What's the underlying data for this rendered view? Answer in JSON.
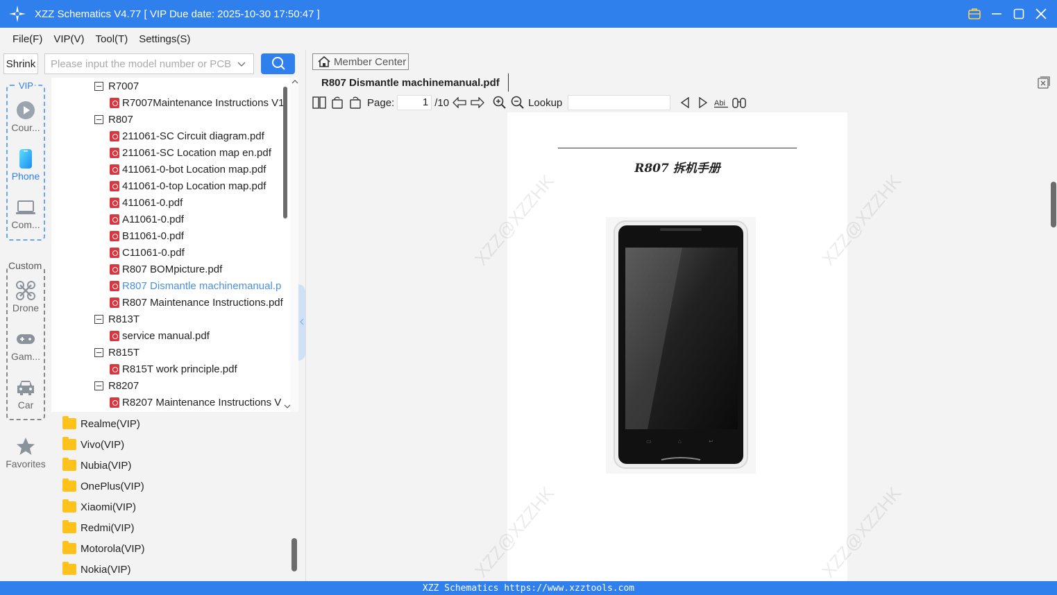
{
  "window": {
    "title": "XZZ Schematics V4.77 [ VIP Due date: 2025-10-30 17:50:47 ]"
  },
  "menu": [
    "File(F)",
    "VIP(V)",
    "Tool(T)",
    "Settings(S)"
  ],
  "search": {
    "shrink_label": "Shrink",
    "placeholder": "Please input the model number or PCB"
  },
  "nav": {
    "vip_label": "VIP",
    "custom_label": "Custom",
    "items": [
      {
        "label": "Cour...",
        "icon": "play-circle-icon"
      },
      {
        "label": "Phone",
        "icon": "phone-icon"
      },
      {
        "label": "Com...",
        "icon": "laptop-icon"
      },
      {
        "label": "Drone",
        "icon": "drone-icon"
      },
      {
        "label": "Gam...",
        "icon": "gamepad-icon"
      },
      {
        "label": "Car",
        "icon": "car-icon"
      },
      {
        "label": "Favorites",
        "icon": "star-icon"
      }
    ]
  },
  "tree": [
    {
      "type": "model",
      "label": "R7007"
    },
    {
      "type": "file",
      "label": "R7007Maintenance Instructions V1"
    },
    {
      "type": "model",
      "label": "R807"
    },
    {
      "type": "file",
      "label": "211061-SC Circuit diagram.pdf"
    },
    {
      "type": "file",
      "label": "211061-SC Location map en.pdf"
    },
    {
      "type": "file",
      "label": "411061-0-bot Location map.pdf"
    },
    {
      "type": "file",
      "label": "411061-0-top Location map.pdf"
    },
    {
      "type": "file",
      "label": "411061-0.pdf"
    },
    {
      "type": "file",
      "label": "A11061-0.pdf"
    },
    {
      "type": "file",
      "label": "B11061-0.pdf"
    },
    {
      "type": "file",
      "label": "C11061-0.pdf"
    },
    {
      "type": "file",
      "label": "R807 BOMpicture.pdf"
    },
    {
      "type": "file",
      "label": "R807 Dismantle machinemanual.p",
      "selected": true
    },
    {
      "type": "file",
      "label": "R807 Maintenance Instructions.pdf"
    },
    {
      "type": "model",
      "label": "R813T"
    },
    {
      "type": "file",
      "label": "service manual.pdf"
    },
    {
      "type": "model",
      "label": "R815T"
    },
    {
      "type": "file",
      "label": "R815T work principle.pdf"
    },
    {
      "type": "model",
      "label": "R8207"
    },
    {
      "type": "file",
      "label": "R8207 Maintenance Instructions V"
    }
  ],
  "folders": [
    "Realme(VIP)",
    "Vivo(VIP)",
    "Nubia(VIP)",
    "OnePlus(VIP)",
    "Xiaomi(VIP)",
    "Redmi(VIP)",
    "Motorola(VIP)",
    "Nokia(VIP)"
  ],
  "viewer": {
    "member_center": "Member Center",
    "doc_title": "R807 Dismantle machinemanual.pdf",
    "page_label": "Page:",
    "page_value": "1",
    "page_total": "/10",
    "lookup_label": "Lookup",
    "page_heading": "R807 拆机手册",
    "watermark": "XZZ@XZZHK"
  },
  "status": "XZZ Schematics https://www.xzztools.com",
  "colors": {
    "accent": "#2f80ed",
    "pdf": "#d9363e",
    "folder": "#ffc21a",
    "selected_text": "#4a90e2"
  }
}
